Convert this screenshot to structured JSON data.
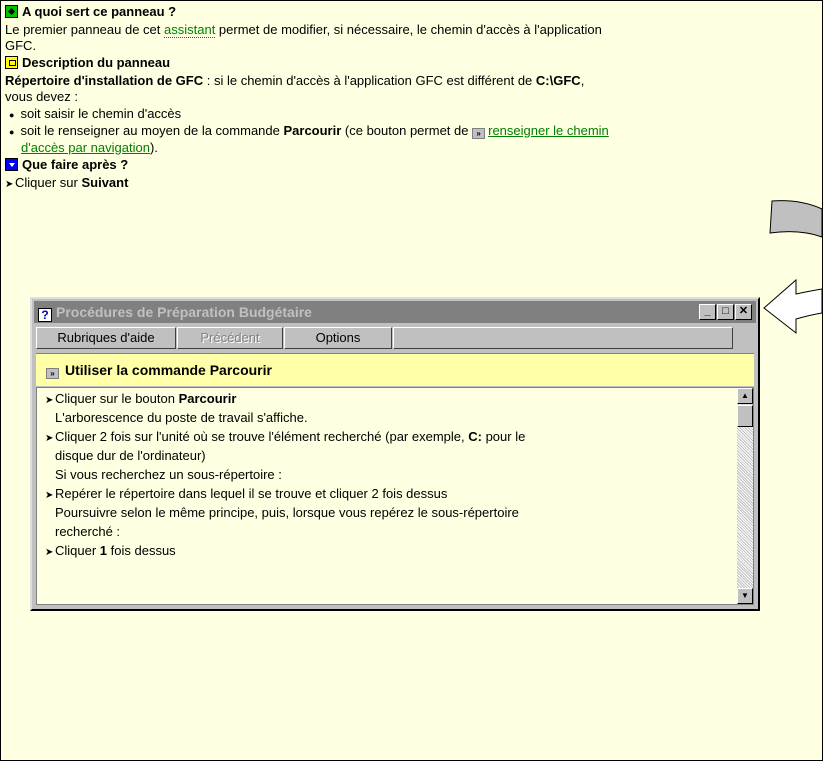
{
  "help": {
    "section1_title": "A quoi sert ce panneau ?",
    "section1_text_a": "Le premier panneau de cet ",
    "section1_link": "assistant",
    "section1_text_b": " permet de modifier, si nécessaire, le chemin d'accès à l'application",
    "section1_text_c": "GFC.",
    "section2_title": "Description du panneau",
    "repertoire_label": "Répertoire d'installation de GFC",
    "repertoire_text": " : si le chemin d'accès à l'application GFC est différent de ",
    "repertoire_path": "C:\\GFC",
    "repertoire_end": ",",
    "vous_devez": "vous devez :",
    "bullet1": "soit saisir le chemin d'accès",
    "bullet2_a": "soit le renseigner au moyen de la commande ",
    "bullet2_bold": "Parcourir",
    "bullet2_b": " (ce bouton permet de ",
    "bullet2_link_a": "renseigner le chemin",
    "bullet2_link_b": "d'accès par navigation",
    "bullet2_end": ").",
    "section3_title": "Que faire après ?",
    "step_a": "Cliquer sur ",
    "step_bold": "Suivant"
  },
  "popup": {
    "title": "Procédures de Préparation Budgétaire",
    "buttons": {
      "topics": "Rubriques d'aide",
      "previous": "Précédent",
      "options": "Options"
    },
    "topic_title": "Utiliser la commande Parcourir",
    "lines": {
      "l1a": "Cliquer sur le bouton ",
      "l1b": "Parcourir",
      "l2": "L'arborescence du poste de travail s'affiche.",
      "l3a": "Cliquer 2 fois sur l'unité où se trouve l'élément recherché (par exemple, ",
      "l3b": "C:",
      "l3c": " pour le",
      "l4": "disque dur de l'ordinateur)",
      "l5": "Si vous recherchez un sous-répertoire :",
      "l6": "Repérer le répertoire dans lequel il se trouve et cliquer 2 fois dessus",
      "l7": "Poursuivre selon le même principe, puis, lorsque vous repérez le sous-répertoire",
      "l8": "recherché :",
      "l9a": "Cliquer ",
      "l9b": "1",
      "l9c": " fois dessus"
    }
  },
  "icons": [
    "green-diamond-icon",
    "yellow-panel-icon",
    "blue-arrow-icon",
    "jump-icon",
    "help-question-icon",
    "minimize-icon",
    "maximize-icon",
    "close-icon",
    "callout-arrow-icon"
  ]
}
